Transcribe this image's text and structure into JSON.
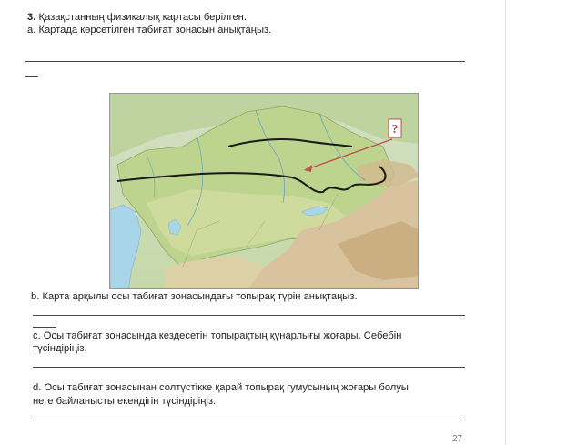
{
  "task": {
    "number": "3.",
    "intro": "Қазақстанның физикалық картасы берілген.",
    "a": "a. Картада көрсетілген табиғат зонасын анықтаңыз.",
    "b": "b. Карта арқылы осы табиғат зонасындағы топырақ   түрін анықтаңыз.",
    "c1": "c. Осы табиғат зонасында кездесетін топырақтың құнарлығы жоғары. Себебін",
    "c2": "түсіндіріңіз.",
    "d1": "d. Осы табиғат зонасынан солтүстікке қарай топырақ гумусының жоғары болуы",
    "d2": "неге байланысты екендігін түсіндіріңіз."
  },
  "map": {
    "question_mark": "?",
    "colors": {
      "lowland": "#b8cf88",
      "steppe": "#cad89a",
      "highland": "#d9c6a2",
      "water": "#a9d5e8",
      "boundary": "#1a1a1a",
      "pointer": "#c0504d"
    }
  },
  "page_number": "27"
}
